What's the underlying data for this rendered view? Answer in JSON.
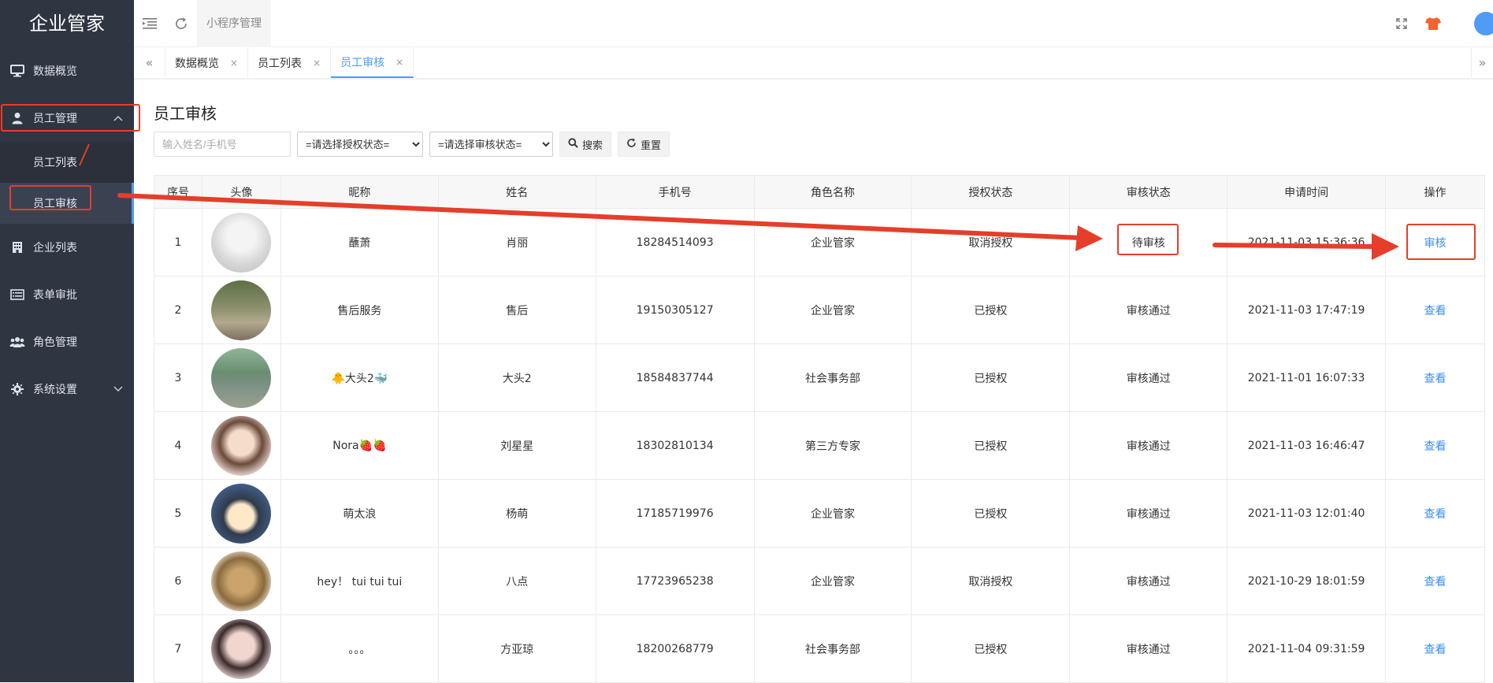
{
  "app": {
    "title": "企业管家"
  },
  "sidebar": {
    "items": [
      {
        "label": "数据概览",
        "icon": "monitor-icon"
      },
      {
        "label": "员工管理",
        "icon": "user-icon",
        "expanded": true,
        "children": [
          {
            "label": "员工列表"
          },
          {
            "label": "员工审核",
            "active": true
          }
        ]
      },
      {
        "label": "企业列表",
        "icon": "building-icon"
      },
      {
        "label": "表单审批",
        "icon": "list-icon"
      },
      {
        "label": "角色管理",
        "icon": "users-icon"
      },
      {
        "label": "系统设置",
        "icon": "gear-icon"
      }
    ]
  },
  "topbar": {
    "mini_program": "小程序管理"
  },
  "tabs": [
    {
      "label": "数据概览"
    },
    {
      "label": "员工列表"
    },
    {
      "label": "员工审核",
      "active": true
    }
  ],
  "page": {
    "title": "员工审核"
  },
  "search": {
    "placeholder": "输入姓名/手机号",
    "auth_select": "=请选择授权状态=",
    "audit_select": "=请选择审核状态=",
    "search_label": "搜索",
    "reset_label": "重置"
  },
  "table": {
    "headers": [
      "序号",
      "头像",
      "昵称",
      "姓名",
      "手机号",
      "角色名称",
      "授权状态",
      "审核状态",
      "申请时间",
      "操作"
    ],
    "rows": [
      {
        "no": "1",
        "nickname": "蘸萧",
        "name": "肖丽",
        "phone": "18284514093",
        "role": "企业管家",
        "auth": "取消授权",
        "audit": "待审核",
        "time": "2021-11-03 15:36:36",
        "action": "审核"
      },
      {
        "no": "2",
        "nickname": "售后服务",
        "name": "售后",
        "phone": "19150305127",
        "role": "企业管家",
        "auth": "已授权",
        "audit": "审核通过",
        "time": "2021-11-03 17:47:19",
        "action": "查看"
      },
      {
        "no": "3",
        "nickname": "🐥大头2🐳",
        "name": "大头2",
        "phone": "18584837744",
        "role": "社会事务部",
        "auth": "已授权",
        "audit": "审核通过",
        "time": "2021-11-01 16:07:33",
        "action": "查看"
      },
      {
        "no": "4",
        "nickname": "Nora🍓🍓",
        "name": "刘星星",
        "phone": "18302810134",
        "role": "第三方专家",
        "auth": "已授权",
        "audit": "审核通过",
        "time": "2021-11-03 16:46:47",
        "action": "查看"
      },
      {
        "no": "5",
        "nickname": "萌太浪",
        "name": "杨萌",
        "phone": "17185719976",
        "role": "企业管家",
        "auth": "已授权",
        "audit": "审核通过",
        "time": "2021-11-03 12:01:40",
        "action": "查看"
      },
      {
        "no": "6",
        "nickname": "hey！ tui tui tui",
        "name": "八点",
        "phone": "17723965238",
        "role": "企业管家",
        "auth": "取消授权",
        "audit": "审核通过",
        "time": "2021-10-29 18:01:59",
        "action": "查看"
      },
      {
        "no": "7",
        "nickname": "。。。",
        "name": "方亚琼",
        "phone": "18200268779",
        "role": "社会事务部",
        "auth": "已授权",
        "audit": "审核通过",
        "time": "2021-11-04 09:31:59",
        "action": "查看"
      }
    ]
  },
  "colors": {
    "sidebar_bg": "#2f3541",
    "accent": "#4f9bf5",
    "annotation": "#e53e2a",
    "link": "#3b8cf0"
  }
}
